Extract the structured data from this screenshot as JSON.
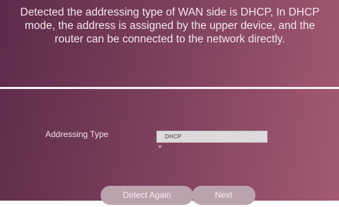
{
  "message": "Detected the addressing type of WAN side is DHCP, In DHCP mode, the address is assigned by the upper device, and the router can be connected to the network directly.",
  "form": {
    "addressing_label": "Addressing Type",
    "addressing_value": "DHCP",
    "addressing_icon": "chevron-down-icon"
  },
  "buttons": {
    "detect_again": "Detect Again",
    "next": "Next"
  },
  "colors": {
    "panel_start": "#5e2a4b",
    "panel_end": "#a45a72",
    "button_bg": "#bba3ae"
  }
}
